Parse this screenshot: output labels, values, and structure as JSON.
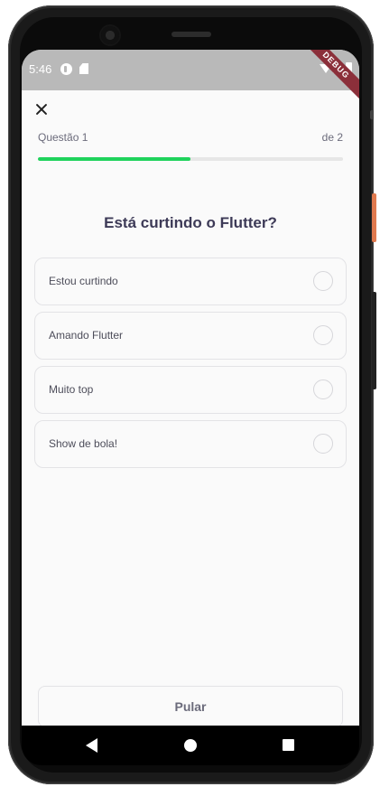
{
  "status_bar": {
    "time": "5:46",
    "debug_label": "DEBUG"
  },
  "quiz": {
    "question_label": "Questão 1",
    "total_label": "de 2",
    "progress": 0.5,
    "title": "Está curtindo o Flutter?",
    "answers": [
      {
        "label": "Estou curtindo",
        "selected": false
      },
      {
        "label": "Amando Flutter",
        "selected": false
      },
      {
        "label": "Muito top",
        "selected": false
      },
      {
        "label": "Show de bola!",
        "selected": false
      }
    ],
    "skip_label": "Pular"
  },
  "colors": {
    "accent": "#1fd35c",
    "title": "#3d3a57",
    "status_bar": "#b9b9b9"
  }
}
